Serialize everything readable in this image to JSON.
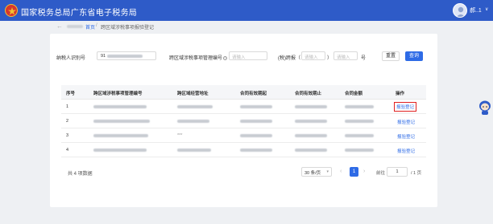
{
  "header": {
    "site_title": "国家税务总局广东省电子税务局",
    "user_name": "郝..1",
    "user_caret": "∨"
  },
  "breadcrumb": {
    "back_symbol": "←",
    "home": "首页",
    "separator": "/",
    "current": "跨区域涉税事项报验登记"
  },
  "search": {
    "taxpayer_id_label": "纳税人识别号",
    "taxpayer_id_value": "91",
    "mgmt_no_label": "跨区域涉税事项管理编号",
    "mgmt_no_placeholder": "请输入",
    "mgmt_no_prefix_label": "(税)跨报（",
    "mgmt_no_part1_placeholder": "请输入",
    "mgmt_no_mid": "）",
    "mgmt_no_part2_placeholder": "请输入",
    "mgmt_no_suffix": "号",
    "reset_label": "重置",
    "query_label": "查询"
  },
  "table": {
    "columns": [
      "序号",
      "跨区域涉税事项管理编号",
      "跨区域经营地址",
      "合同有效期起",
      "合同有效期止",
      "合同金额",
      "操作"
    ],
    "rows": [
      {
        "index": "1",
        "action": "报验登记",
        "highlighted": true
      },
      {
        "index": "2",
        "action": "报验登记",
        "highlighted": false
      },
      {
        "index": "3",
        "action": "报验登记",
        "highlighted": false,
        "address_text": "***"
      },
      {
        "index": "4",
        "action": "报验登记",
        "highlighted": false
      }
    ]
  },
  "pagination": {
    "total_text": "共 4 项数据",
    "page_size": "30 条/页",
    "prev": "‹",
    "current_page": "1",
    "next": "›",
    "goto_label": "前往",
    "goto_value": "1",
    "total_pages": "/ 1 页"
  },
  "colors": {
    "brand_blue": "#2e5bc8",
    "link_blue": "#2e6be6",
    "highlight_red": "#e02020"
  }
}
